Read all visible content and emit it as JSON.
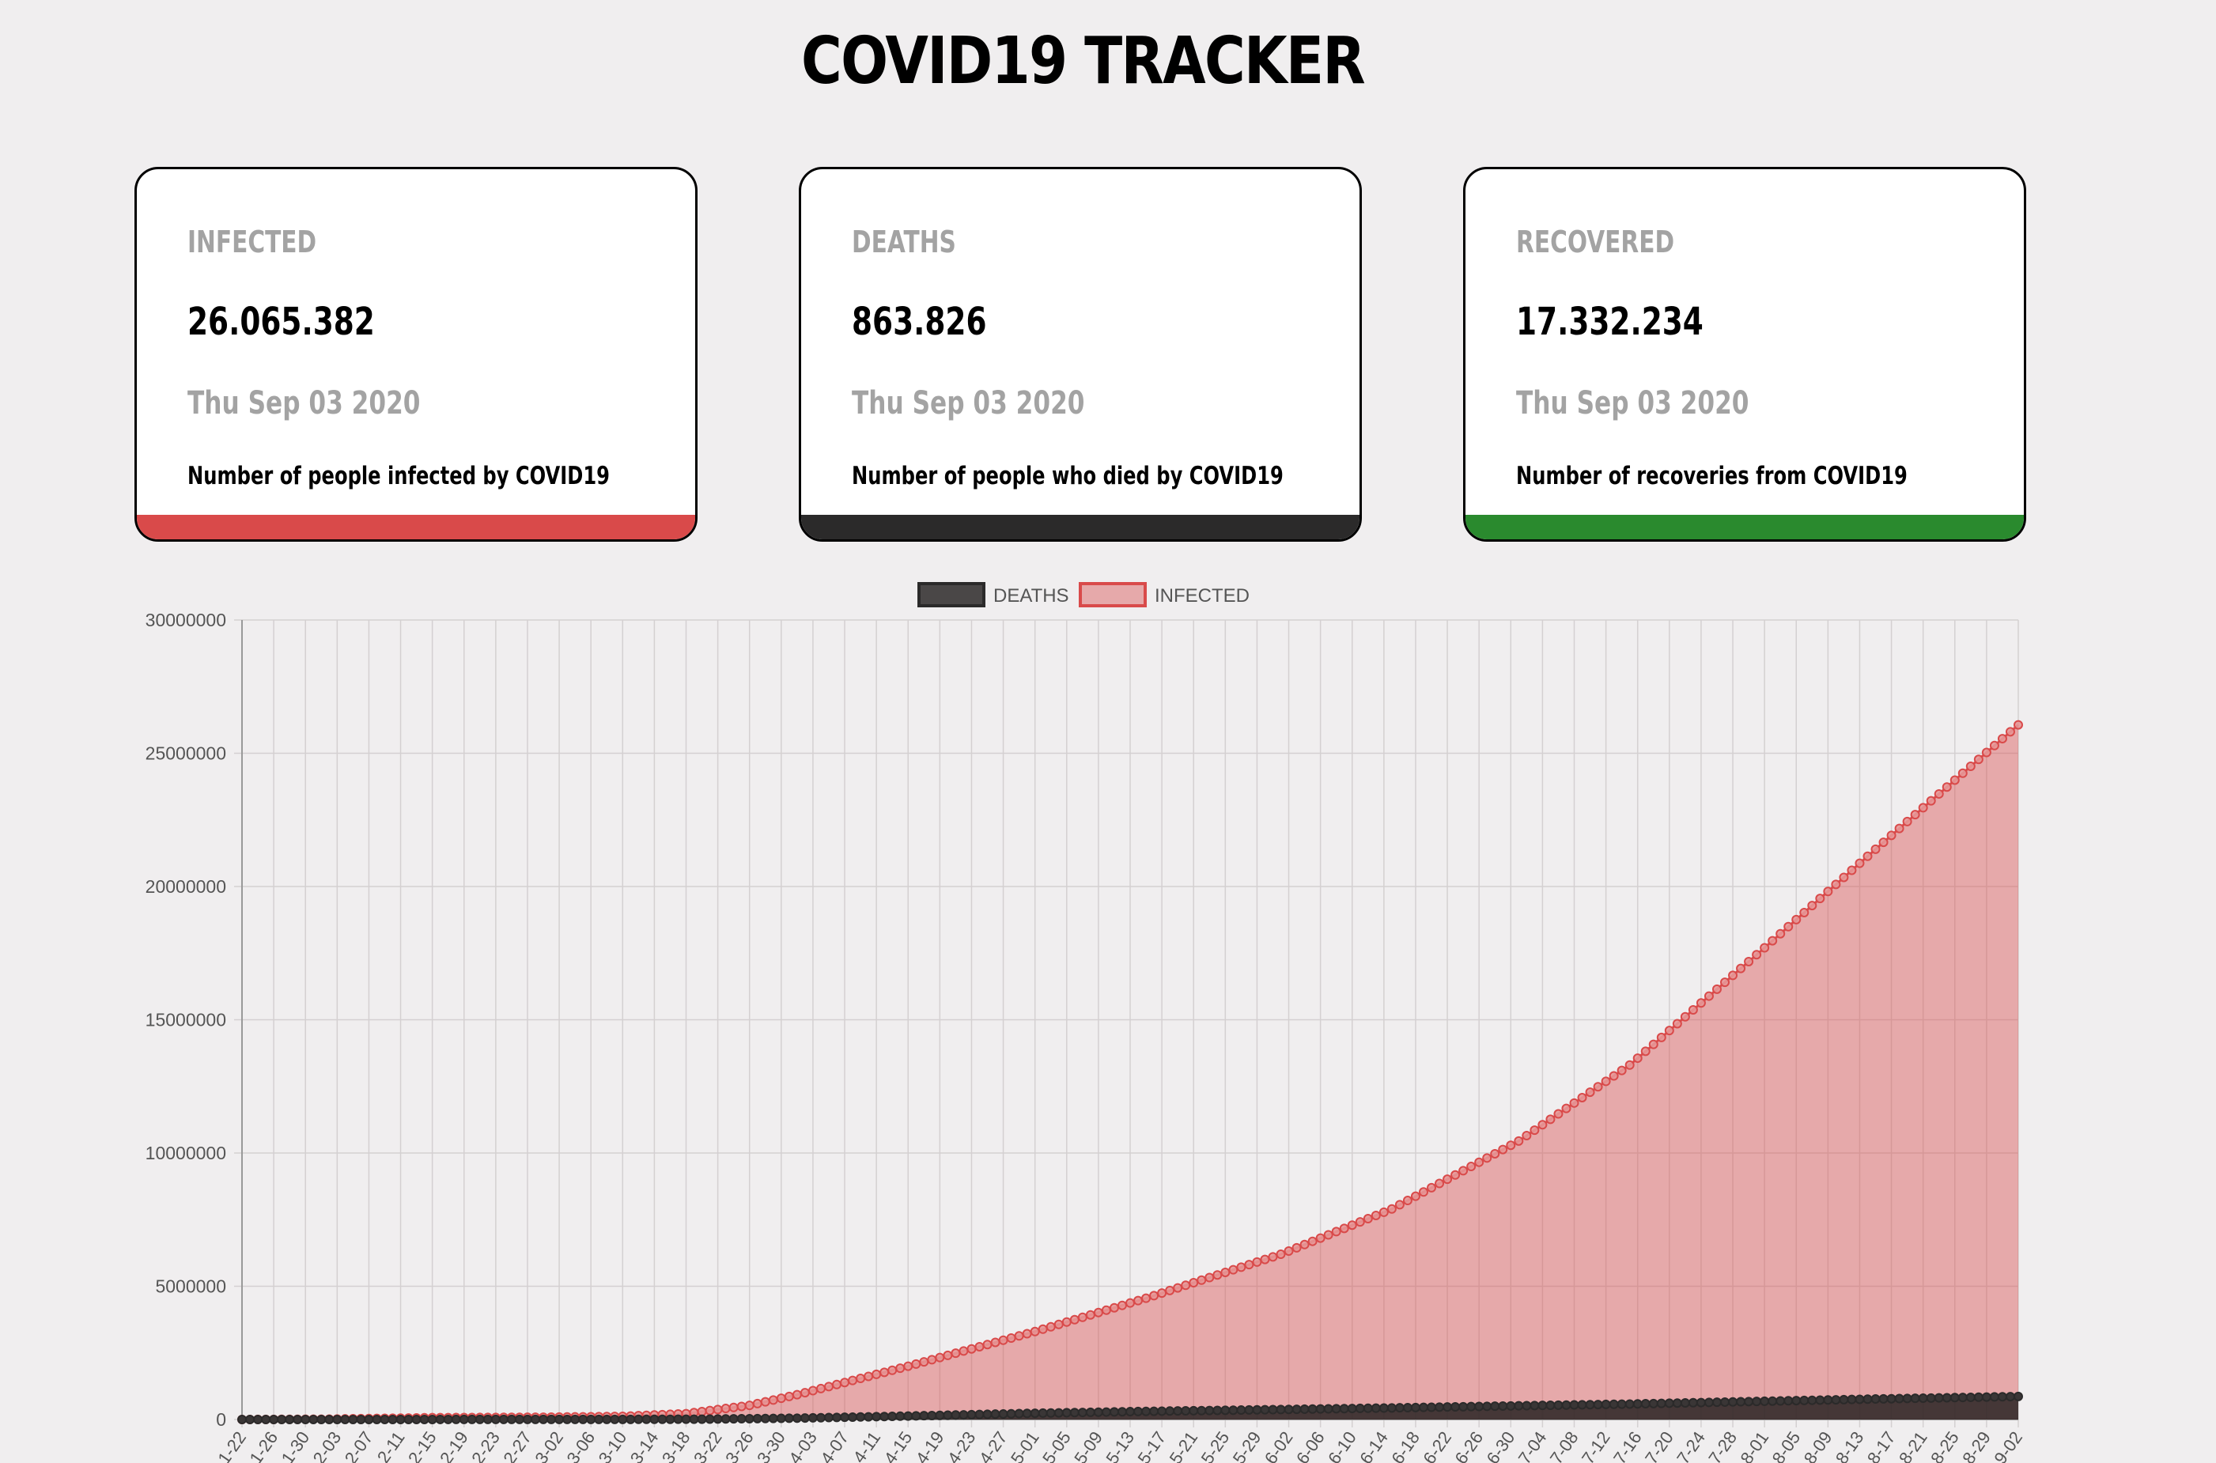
{
  "header": {
    "title": "COVID19 TRACKER"
  },
  "cards": [
    {
      "key": "infected",
      "label": "INFECTED",
      "value": "26.065.382",
      "date": "Thu Sep 03 2020",
      "description": "Number of people infected by COVID19",
      "color": "#d94a4a"
    },
    {
      "key": "deaths",
      "label": "DEATHS",
      "value": "863.826",
      "date": "Thu Sep 03 2020",
      "description": "Number of people who died by COVID19",
      "color": "#2b2a2a"
    },
    {
      "key": "recovered",
      "label": "RECOVERED",
      "value": "17.332.234",
      "date": "Thu Sep 03 2020",
      "description": "Number of recoveries from COVID19",
      "color": "#2a8a2e"
    }
  ],
  "chart_data": {
    "type": "area",
    "legend": {
      "position": "top"
    },
    "grid": true,
    "ylim": [
      0,
      30000000
    ],
    "yticks": [
      "0",
      "5000000",
      "10000000",
      "15000000",
      "20000000",
      "25000000",
      "30000000"
    ],
    "x_range": [
      "2020-01-22",
      "2020-09-02"
    ],
    "x_tick_every_days": 4,
    "x_tick_labels": [
      "1-22",
      "1-26",
      "1-30",
      "2-03",
      "2-07",
      "2-11",
      "2-15",
      "2-19",
      "2-23",
      "2-27",
      "3-02",
      "3-06",
      "3-10",
      "3-14",
      "3-18",
      "3-22",
      "3-26",
      "3-30",
      "4-03",
      "4-07",
      "4-11",
      "4-15",
      "4-19",
      "4-23",
      "4-27",
      "5-01",
      "5-05",
      "5-09",
      "5-13",
      "5-17",
      "5-21",
      "5-25",
      "5-29",
      "6-02",
      "6-06",
      "6-10",
      "6-14",
      "6-18",
      "6-22",
      "6-26",
      "6-30",
      "7-04",
      "7-08",
      "7-12",
      "7-16",
      "7-20",
      "7-24",
      "7-28",
      "8-01",
      "8-05",
      "8-09",
      "8-13",
      "8-17",
      "8-21",
      "8-25",
      "8-29",
      "9-02"
    ],
    "series": [
      {
        "name": "DEATHS",
        "color": "#2b2a2a",
        "fill": "rgba(40,35,35,0.85)",
        "points": [
          [
            "2020-01-22",
            17
          ],
          [
            "2020-02-15",
            1600
          ],
          [
            "2020-03-10",
            4200
          ],
          [
            "2020-03-20",
            12000
          ],
          [
            "2020-04-01",
            50000
          ],
          [
            "2020-04-15",
            130000
          ],
          [
            "2020-05-01",
            235000
          ],
          [
            "2020-05-15",
            305000
          ],
          [
            "2020-06-01",
            375000
          ],
          [
            "2020-06-15",
            435000
          ],
          [
            "2020-07-01",
            515000
          ],
          [
            "2020-07-15",
            580000
          ],
          [
            "2020-08-01",
            685000
          ],
          [
            "2020-08-15",
            770000
          ],
          [
            "2020-09-02",
            863826
          ]
        ]
      },
      {
        "name": "INFECTED",
        "color": "#d94a4a",
        "fill": "rgba(217,74,74,0.42)",
        "points": [
          [
            "2020-01-22",
            555
          ],
          [
            "2020-02-01",
            12000
          ],
          [
            "2020-02-15",
            69000
          ],
          [
            "2020-03-01",
            88000
          ],
          [
            "2020-03-10",
            119000
          ],
          [
            "2020-03-18",
            220000
          ],
          [
            "2020-03-26",
            530000
          ],
          [
            "2020-04-01",
            930000
          ],
          [
            "2020-04-15",
            2000000
          ],
          [
            "2020-05-01",
            3300000
          ],
          [
            "2020-05-15",
            4550000
          ],
          [
            "2020-06-01",
            6200000
          ],
          [
            "2020-06-15",
            7900000
          ],
          [
            "2020-07-01",
            10450000
          ],
          [
            "2020-07-15",
            13300000
          ],
          [
            "2020-08-01",
            17700000
          ],
          [
            "2020-08-15",
            21400000
          ],
          [
            "2020-09-02",
            26065382
          ]
        ]
      }
    ]
  }
}
